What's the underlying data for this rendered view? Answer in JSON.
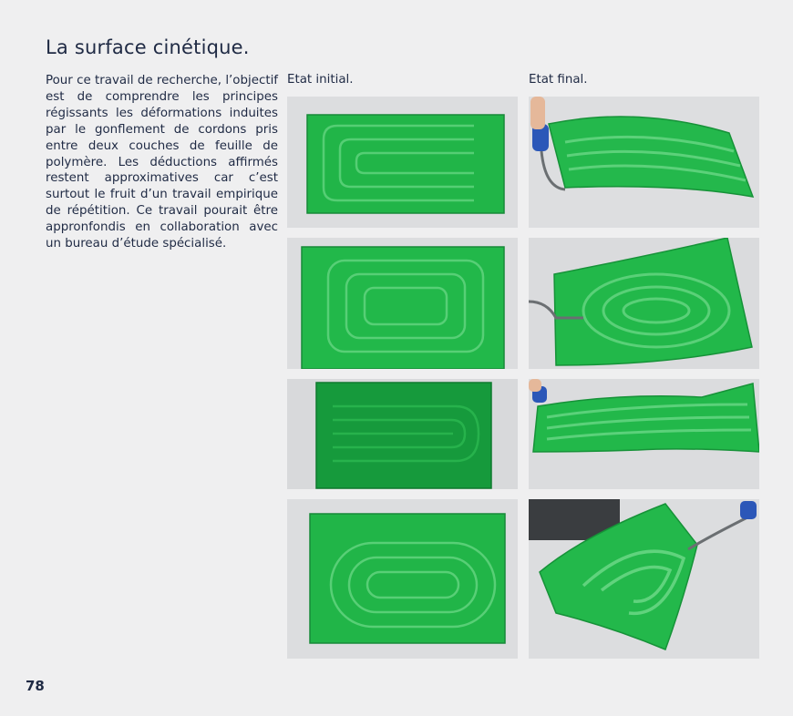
{
  "page": {
    "title": "La surface cinétique.",
    "paragraph": "Pour ce travail de recherche, l’objectif est de comprendre les principes régissants les déformations induites par le gonflement de cordons pris entre deux couches de feuille de polymère. Les déductions affirmés restent approximatives car c’est surtout le fruit d’un travail empirique de répétition. Ce travail pourait être appronfondis en collaboration avec un bureau d’étude spécialisé.",
    "columns": {
      "initial_label": "Etat initial.",
      "final_label": "Etat final."
    },
    "page_number": "78"
  },
  "colors": {
    "text": "#1f2a44",
    "background": "#efeff0",
    "green": "#22b84a",
    "dark_green": "#15893a"
  }
}
